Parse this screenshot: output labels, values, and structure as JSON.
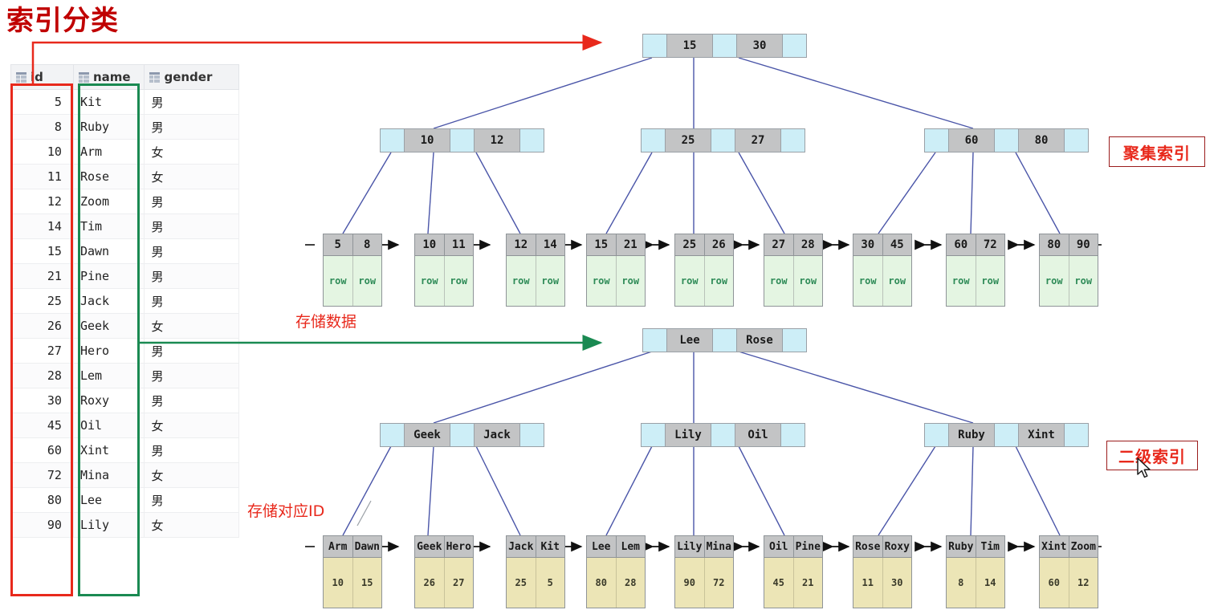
{
  "title": "索引分类",
  "table": {
    "columns": [
      {
        "label": "id",
        "icon": "table-key-icon"
      },
      {
        "label": "name",
        "icon": "table-column-icon"
      },
      {
        "label": "gender",
        "icon": "table-column-icon"
      }
    ],
    "rows": [
      {
        "id": "5",
        "name": "Kit",
        "gender": "男"
      },
      {
        "id": "8",
        "name": "Ruby",
        "gender": "男"
      },
      {
        "id": "10",
        "name": "Arm",
        "gender": "女"
      },
      {
        "id": "11",
        "name": "Rose",
        "gender": "女"
      },
      {
        "id": "12",
        "name": "Zoom",
        "gender": "男"
      },
      {
        "id": "14",
        "name": "Tim",
        "gender": "男"
      },
      {
        "id": "15",
        "name": "Dawn",
        "gender": "男"
      },
      {
        "id": "21",
        "name": "Pine",
        "gender": "男"
      },
      {
        "id": "25",
        "name": "Jack",
        "gender": "男"
      },
      {
        "id": "26",
        "name": "Geek",
        "gender": "女"
      },
      {
        "id": "27",
        "name": "Hero",
        "gender": "男"
      },
      {
        "id": "28",
        "name": "Lem",
        "gender": "男"
      },
      {
        "id": "30",
        "name": "Roxy",
        "gender": "男"
      },
      {
        "id": "45",
        "name": "Oil",
        "gender": "女"
      },
      {
        "id": "60",
        "name": "Xint",
        "gender": "男"
      },
      {
        "id": "72",
        "name": "Mina",
        "gender": "女"
      },
      {
        "id": "80",
        "name": "Lee",
        "gender": "男"
      },
      {
        "id": "90",
        "name": "Lily",
        "gender": "女"
      }
    ]
  },
  "highlight": {
    "id_column_border_color": "#e8291c",
    "name_column_border_color": "#1a8a52"
  },
  "clustered_index": {
    "badge": "聚集索引",
    "note": "存储数据",
    "root": {
      "keys": [
        "15",
        "30"
      ]
    },
    "internal": [
      {
        "keys": [
          "10",
          "12"
        ]
      },
      {
        "keys": [
          "25",
          "27"
        ]
      },
      {
        "keys": [
          "60",
          "80"
        ]
      }
    ],
    "leaves": [
      {
        "keys": [
          "5",
          "8"
        ],
        "values": [
          "row",
          "row"
        ]
      },
      {
        "keys": [
          "10",
          "11"
        ],
        "values": [
          "row",
          "row"
        ]
      },
      {
        "keys": [
          "12",
          "14"
        ],
        "values": [
          "row",
          "row"
        ]
      },
      {
        "keys": [
          "15",
          "21"
        ],
        "values": [
          "row",
          "row"
        ]
      },
      {
        "keys": [
          "25",
          "26"
        ],
        "values": [
          "row",
          "row"
        ]
      },
      {
        "keys": [
          "27",
          "28"
        ],
        "values": [
          "row",
          "row"
        ]
      },
      {
        "keys": [
          "30",
          "45"
        ],
        "values": [
          "row",
          "row"
        ]
      },
      {
        "keys": [
          "60",
          "72"
        ],
        "values": [
          "row",
          "row"
        ]
      },
      {
        "keys": [
          "80",
          "90"
        ],
        "values": [
          "row",
          "row"
        ]
      }
    ]
  },
  "secondary_index": {
    "badge": "二级索引",
    "note": "存储对应ID",
    "root": {
      "keys": [
        "Lee",
        "Rose"
      ]
    },
    "internal": [
      {
        "keys": [
          "Geek",
          "Jack"
        ]
      },
      {
        "keys": [
          "Lily",
          "Oil"
        ]
      },
      {
        "keys": [
          "Ruby",
          "Xint"
        ]
      }
    ],
    "leaves": [
      {
        "keys": [
          "Arm",
          "Dawn"
        ],
        "values": [
          "10",
          "15"
        ]
      },
      {
        "keys": [
          "Geek",
          "Hero"
        ],
        "values": [
          "26",
          "27"
        ]
      },
      {
        "keys": [
          "Jack",
          "Kit"
        ],
        "values": [
          "25",
          "5"
        ]
      },
      {
        "keys": [
          "Lee",
          "Lem"
        ],
        "values": [
          "80",
          "28"
        ]
      },
      {
        "keys": [
          "Lily",
          "Mina"
        ],
        "values": [
          "90",
          "72"
        ]
      },
      {
        "keys": [
          "Oil",
          "Pine"
        ],
        "values": [
          "45",
          "21"
        ]
      },
      {
        "keys": [
          "Rose",
          "Roxy"
        ],
        "values": [
          "11",
          "30"
        ]
      },
      {
        "keys": [
          "Ruby",
          "Tim"
        ],
        "values": [
          "8",
          "14"
        ]
      },
      {
        "keys": [
          "Xint",
          "Zoom"
        ],
        "values": [
          "60",
          "12"
        ]
      }
    ]
  },
  "colors": {
    "title": "#c00000",
    "accent_red": "#e8291c",
    "accent_green": "#1a8a52",
    "node_gray": "#c3c4c5",
    "pointer_blue": "#cdeef7",
    "row_green": "#e4f5e2",
    "id_tan": "#ece5b6",
    "edge_blue": "#4a55a8"
  }
}
